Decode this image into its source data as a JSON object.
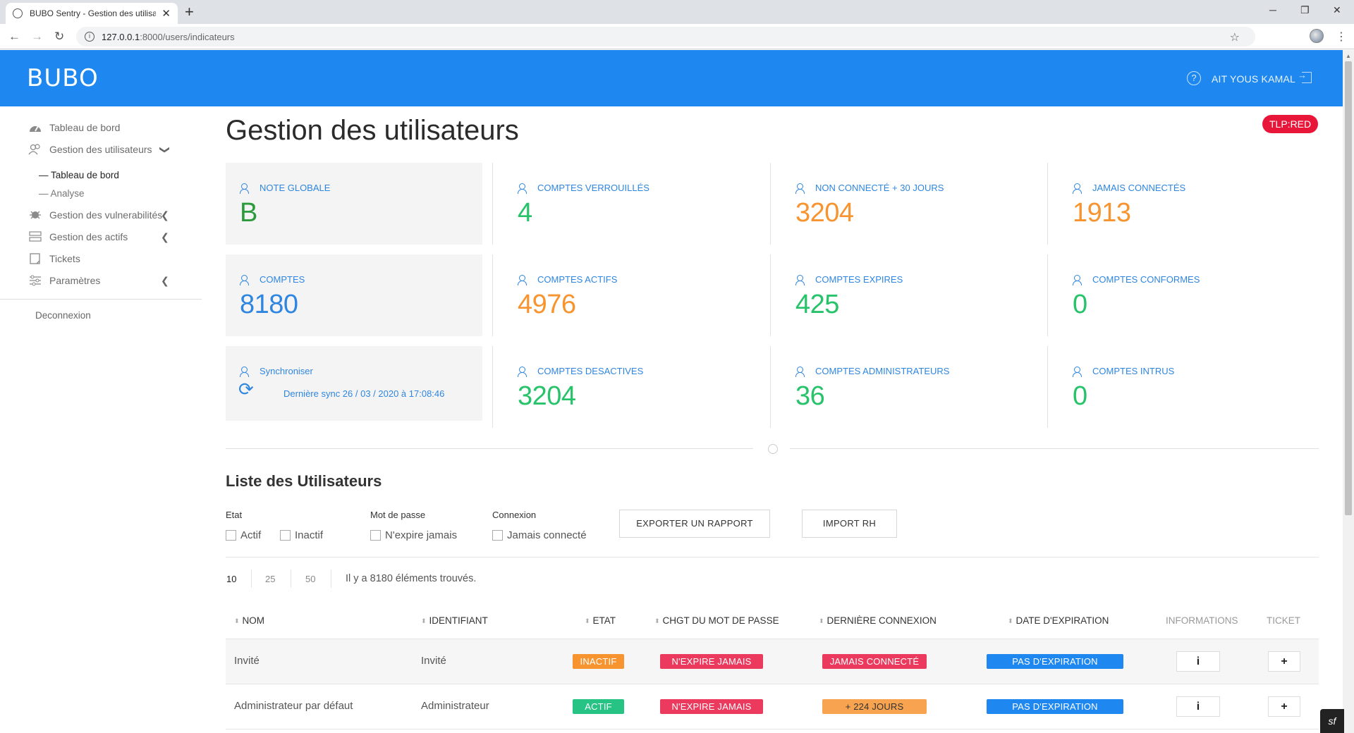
{
  "browser": {
    "tab_title": "BUBO Sentry - Gestion des utilisa",
    "url_host": "127.0.0.1",
    "url_path": ":8000/users/indicateurs"
  },
  "header": {
    "logo": "BUBO",
    "username": "AIT YOUS KAMAL",
    "help": "?"
  },
  "sidebar": {
    "items": [
      {
        "label": "Tableau de bord",
        "icon": "gauge-icon"
      },
      {
        "label": "Gestion des utilisateurs",
        "icon": "users-icon"
      },
      {
        "label": "Gestion des vulnerabilités",
        "icon": "bug-icon"
      },
      {
        "label": "Gestion des actifs",
        "icon": "server-icon"
      },
      {
        "label": "Tickets",
        "icon": "ticket-icon"
      },
      {
        "label": "Paramètres",
        "icon": "sliders-icon"
      }
    ],
    "subitems": [
      "Tableau de bord",
      "Analyse"
    ],
    "logout": "Deconnexion"
  },
  "page": {
    "title": "Gestion des utilisateurs",
    "tlp": "TLP:RED"
  },
  "cards": [
    {
      "label": "NOTE GLOBALE",
      "value": "B"
    },
    {
      "label": "COMPTES VERROUILLÉS",
      "value": "4"
    },
    {
      "label": "NON CONNECTÉ + 30 JOURS",
      "value": "3204"
    },
    {
      "label": "JAMAIS CONNECTÉS",
      "value": "1913"
    },
    {
      "label": "COMPTES",
      "value": "8180"
    },
    {
      "label": "COMPTES ACTIFS",
      "value": "4976"
    },
    {
      "label": "COMPTES EXPIRES",
      "value": "425"
    },
    {
      "label": "COMPTES CONFORMES",
      "value": "0"
    },
    {
      "label": "Synchroniser",
      "value": "Dernière sync 26 / 03 / 2020 à 17:08:46"
    },
    {
      "label": "COMPTES DESACTIVES",
      "value": "3204"
    },
    {
      "label": "COMPTES ADMINISTRATEURS",
      "value": "36"
    },
    {
      "label": "COMPTES INTRUS",
      "value": "0"
    }
  ],
  "list": {
    "title": "Liste des Utilisateurs",
    "filters": {
      "etat": {
        "title": "Etat",
        "options": [
          "Actif",
          "Inactif"
        ]
      },
      "password": {
        "title": "Mot de passe",
        "options": [
          "N'expire jamais"
        ]
      },
      "connexion": {
        "title": "Connexion",
        "options": [
          "Jamais connecté"
        ]
      }
    },
    "export_button": "EXPORTER UN RAPPORT",
    "import_button": "IMPORT RH",
    "page_sizes": [
      "10",
      "25",
      "50"
    ],
    "found_text": "Il y a 8180 éléments trouvés.",
    "columns": [
      "NOM",
      "IDENTIFIANT",
      "ETAT",
      "CHGT DU MOT DE PASSE",
      "DERNIÈRE CONNEXION",
      "DATE D'EXPIRATION",
      "INFORMATIONS",
      "TICKET"
    ],
    "rows": [
      {
        "nom": "Invité",
        "identifiant": "Invité",
        "etat": "INACTIF",
        "mdp": "N'EXPIRE JAMAIS",
        "connexion": "JAMAIS CONNECTÉ",
        "expiration": "PAS D'EXPIRATION",
        "info": "i",
        "ticket": "+"
      },
      {
        "nom": "Administrateur par défaut",
        "identifiant": "Administrateur",
        "etat": "ACTIF",
        "mdp": "N'EXPIRE JAMAIS",
        "connexion": "+ 224 JOURS",
        "expiration": "PAS D'EXPIRATION",
        "info": "i",
        "ticket": "+"
      }
    ]
  },
  "colors": {
    "header": "#1e88f0",
    "accent_blue": "#2f86e0",
    "green": "#27c36a",
    "orange": "#f79430",
    "red": "#eb3a5d",
    "tlp": "#e8173a"
  }
}
